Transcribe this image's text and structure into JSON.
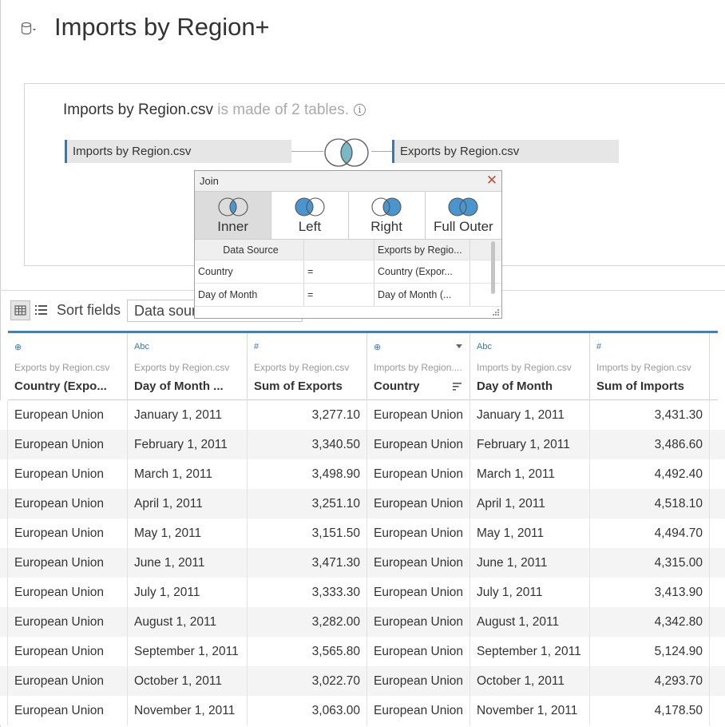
{
  "header": {
    "title": "Imports by Region+",
    "datasource_icon": "database-icon"
  },
  "canvas": {
    "file_name": "Imports by Region.csv",
    "made_of_text": " is made of 2 tables.",
    "left_table": "Imports by Region.csv",
    "right_table": "Exports by Region.csv"
  },
  "join_dialog": {
    "title": "Join",
    "types": [
      {
        "label": "Inner",
        "selected": true
      },
      {
        "label": "Left",
        "selected": false
      },
      {
        "label": "Right",
        "selected": false
      },
      {
        "label": "Full Outer",
        "selected": false
      }
    ],
    "header": {
      "left": "Data Source",
      "op": "",
      "right": "Exports by Regio..."
    },
    "clauses": [
      {
        "left": "Country",
        "op": "=",
        "right": "Country (Expor..."
      },
      {
        "left": "Day of Month",
        "op": "=",
        "right": "Day of Month (..."
      }
    ]
  },
  "toolbar": {
    "sort_label": "Sort fields",
    "sort_value": "Data source order"
  },
  "grid": {
    "columns": [
      {
        "type": "⊕",
        "type_icon": "globe-icon",
        "source": "Exports by Region.csv",
        "name": "Country (Expo..."
      },
      {
        "type": "Abc",
        "type_icon": "string-icon",
        "source": "Exports by Region.csv",
        "name": "Day of Month ..."
      },
      {
        "type": "#",
        "type_icon": "number-icon",
        "source": "Exports by Region.csv",
        "name": "Sum of Exports"
      },
      {
        "type": "⊕",
        "type_icon": "globe-icon",
        "source": "Imports by Region....",
        "name": "Country"
      },
      {
        "type": "Abc",
        "type_icon": "string-icon",
        "source": "Imports by Region.csv",
        "name": "Day of Month"
      },
      {
        "type": "#",
        "type_icon": "number-icon",
        "source": "Imports by Region.csv",
        "name": "Sum of Imports"
      }
    ],
    "rows": [
      [
        "European Union",
        "January 1, 2011",
        "3,277.10",
        "European Union",
        "January 1, 2011",
        "3,431.30"
      ],
      [
        "European Union",
        "February 1, 2011",
        "3,340.50",
        "European Union",
        "February 1, 2011",
        "3,486.60"
      ],
      [
        "European Union",
        "March 1, 2011",
        "3,498.90",
        "European Union",
        "March 1, 2011",
        "4,492.40"
      ],
      [
        "European Union",
        "April 1, 2011",
        "3,251.10",
        "European Union",
        "April 1, 2011",
        "4,518.10"
      ],
      [
        "European Union",
        "May 1, 2011",
        "3,151.50",
        "European Union",
        "May 1, 2011",
        "4,494.70"
      ],
      [
        "European Union",
        "June 1, 2011",
        "3,471.30",
        "European Union",
        "June 1, 2011",
        "4,315.00"
      ],
      [
        "European Union",
        "July 1, 2011",
        "3,333.30",
        "European Union",
        "July 1, 2011",
        "3,413.90"
      ],
      [
        "European Union",
        "August 1, 2011",
        "3,282.00",
        "European Union",
        "August 1, 2011",
        "4,342.80"
      ],
      [
        "European Union",
        "September 1, 2011",
        "3,565.80",
        "European Union",
        "September 1, 2011",
        "5,124.90"
      ],
      [
        "European Union",
        "October 1, 2011",
        "3,022.70",
        "European Union",
        "October 1, 2011",
        "4,293.70"
      ],
      [
        "European Union",
        "November 1, 2011",
        "3,063.00",
        "European Union",
        "November 1, 2011",
        "4,178.50"
      ]
    ]
  },
  "colors": {
    "accent": "#3e76a8",
    "venn_fill": "#4b95cf",
    "venn_inner": "#7ab8c6",
    "close": "#b8523c"
  }
}
